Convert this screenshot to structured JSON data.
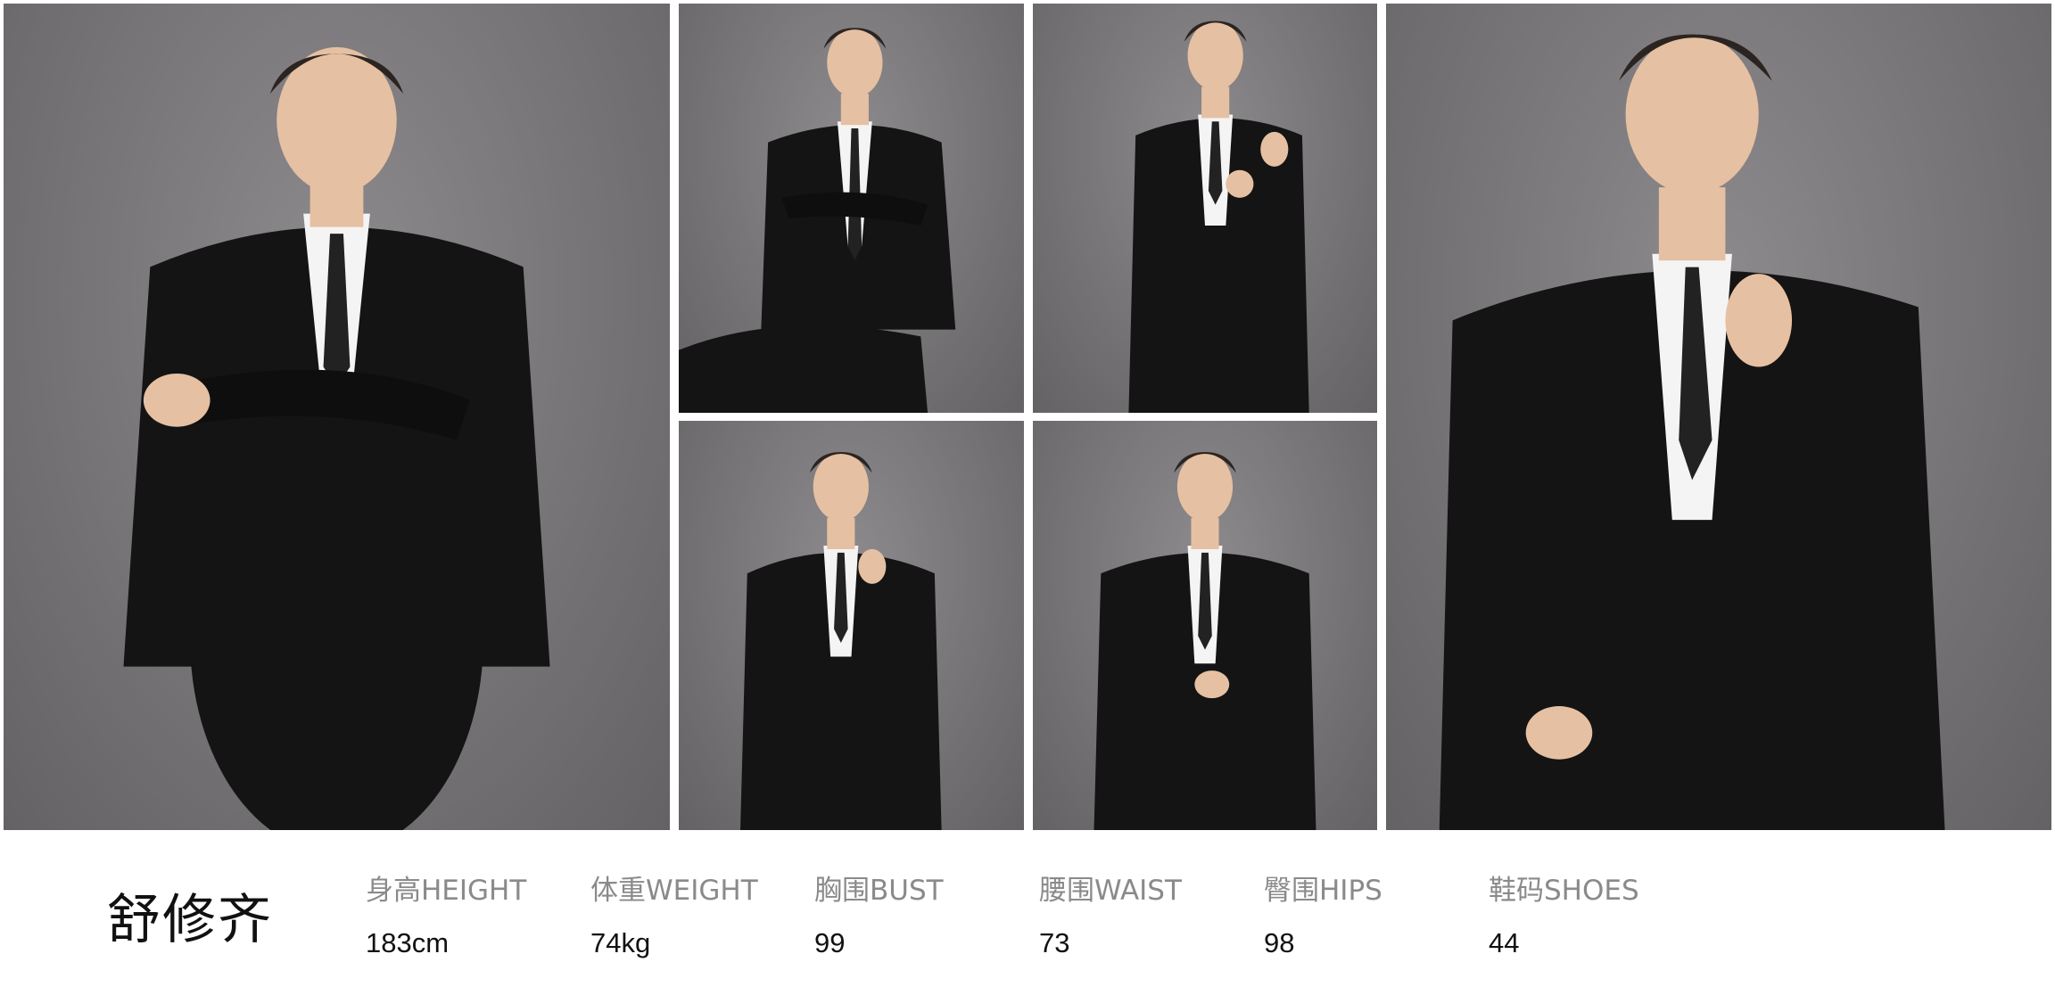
{
  "model": {
    "name": "舒修齐"
  },
  "photos": [
    {
      "subject": "man in black suit, arms crossed, smiling"
    },
    {
      "subject": "man in black suit seated, arms crossed"
    },
    {
      "subject": "man in black suit adjusting cufflink"
    },
    {
      "subject": "man in black suit adjusting tie, hand in pocket"
    },
    {
      "subject": "man in black suit buttoning jacket"
    },
    {
      "subject": "man in black suit adjusting tie, close-up"
    }
  ],
  "stats": [
    {
      "label": "身高HEIGHT",
      "value": "183cm"
    },
    {
      "label": "体重WEIGHT",
      "value": "74kg"
    },
    {
      "label": "胸围BUST",
      "value": "99"
    },
    {
      "label": "腰围WAIST",
      "value": "73"
    },
    {
      "label": "臀围HIPS",
      "value": "98"
    },
    {
      "label": "鞋码SHOES",
      "value": "44"
    }
  ],
  "colors": {
    "backdrop": "#7a787a",
    "suit": "#141414",
    "shirt": "#f4f4f4",
    "skin": "#e6c0a2",
    "hair": "#2c2420",
    "label": "#8a8a8a",
    "text": "#111111"
  }
}
